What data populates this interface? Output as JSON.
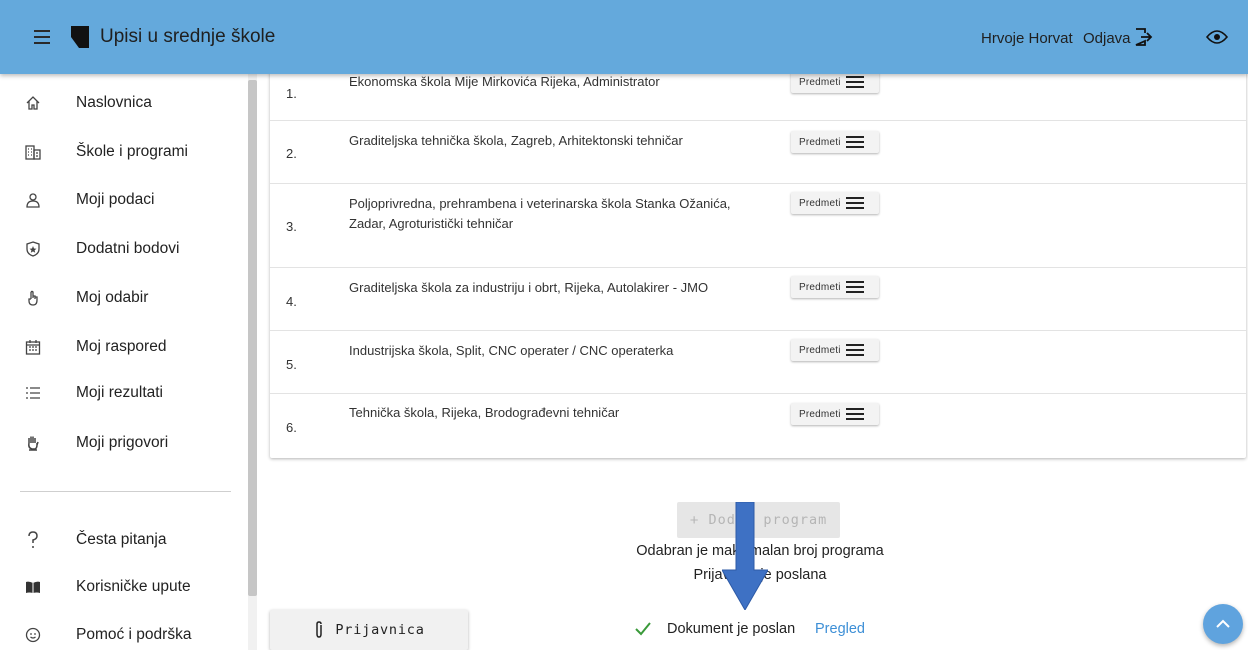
{
  "header": {
    "title": "Upisi u srednje škole",
    "user_name": "Hrvoje Horvat",
    "logout_label": "Odjava"
  },
  "sidebar": {
    "items": [
      {
        "label": "Naslovnica",
        "icon": "home-icon"
      },
      {
        "label": "Škole i programi",
        "icon": "building-icon"
      },
      {
        "label": "Moji podaci",
        "icon": "user-icon"
      },
      {
        "label": "Dodatni bodovi",
        "icon": "star-shield-icon"
      },
      {
        "label": "Moj odabir",
        "icon": "pointer-hand-icon"
      },
      {
        "label": "Moj raspored",
        "icon": "calendar-icon"
      },
      {
        "label": "Moji rezultati",
        "icon": "list-icon"
      },
      {
        "label": "Moji prigovori",
        "icon": "raised-hand-icon"
      }
    ],
    "bottom_items": [
      {
        "label": "Česta pitanja",
        "icon": "question-icon"
      },
      {
        "label": "Korisničke upute",
        "icon": "book-icon"
      },
      {
        "label": "Pomoć i podrška",
        "icon": "support-icon"
      }
    ]
  },
  "programs": {
    "predmeti_label": "Predmeti",
    "rows": [
      {
        "num": "1.",
        "text": "Ekonomska škola Mije Mirkovića Rijeka, Administrator"
      },
      {
        "num": "2.",
        "text": "Graditeljska tehnička škola, Zagreb, Arhitektonski tehničar"
      },
      {
        "num": "3.",
        "text": "Poljoprivredna, prehrambena i veterinarska škola Stanka Ožanića, Zadar, Agroturistički tehničar"
      },
      {
        "num": "4.",
        "text": "Graditeljska škola za industriju i obrt, Rijeka, Autolakirer - JMO"
      },
      {
        "num": "5.",
        "text": "Industrijska škola, Split, CNC operater / CNC operaterka"
      },
      {
        "num": "6.",
        "text": "Tehnička škola, Rijeka, Brodograđevni tehničar"
      }
    ]
  },
  "bottom": {
    "add_program_label": "Dodaj program",
    "max_message": "Odabran je maksimalan broj programa",
    "sent_message": "Prijavnica je poslana",
    "prijavnica_label": "Prijavnica",
    "document_status": "Dokument je poslan",
    "pregled_label": "Pregled"
  },
  "colors": {
    "header_bg": "#64a9dc",
    "link": "#3d8fd6",
    "arrow": "#3e71c4",
    "check": "#3a9a3a"
  }
}
